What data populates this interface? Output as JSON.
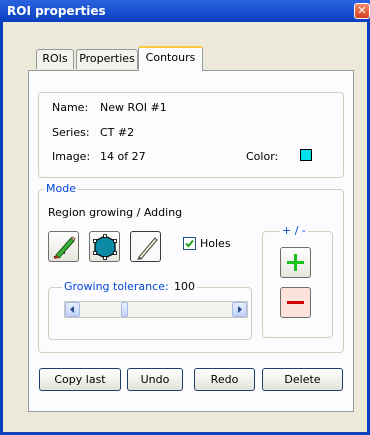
{
  "window": {
    "title": "ROI properties",
    "close_glyph": "✕"
  },
  "tabs": [
    {
      "label": "ROIs",
      "active": false
    },
    {
      "label": "Properties",
      "active": false
    },
    {
      "label": "Contours",
      "active": true
    }
  ],
  "info": {
    "name_label": "Name:",
    "name_value": "New ROI #1",
    "series_label": "Series:",
    "series_value": "CT #2",
    "image_label": "Image:",
    "image_value": "14 of 27",
    "color_label": "Color:",
    "color_swatch": "#00e0e8"
  },
  "mode": {
    "legend": "Mode",
    "description": "Region growing / Adding",
    "tools": [
      {
        "icon": "pen-icon",
        "selected": false
      },
      {
        "icon": "polygon-icon",
        "selected": false
      },
      {
        "icon": "brush-icon",
        "selected": true
      }
    ],
    "holes_label": "Holes",
    "holes_checked": true,
    "growing_tolerance_label": "Growing tolerance:",
    "growing_tolerance_value": "100",
    "tolerance_slider_fraction": 0.28,
    "plusminus_legend": "+ / -",
    "plus_color": "#19c31b",
    "minus_color": "#d00000"
  },
  "buttons": {
    "copy_last": "Copy last",
    "undo": "Undo",
    "redo": "Redo",
    "delete": "Delete"
  }
}
